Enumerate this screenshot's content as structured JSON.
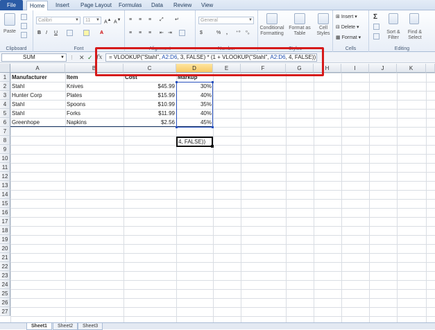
{
  "ribbon": {
    "tabs": [
      "File",
      "Home",
      "Insert",
      "Page Layout",
      "Formulas",
      "Data",
      "Review",
      "View"
    ],
    "active_tab": "Home",
    "clipboard": {
      "paste": "Paste",
      "label": "Clipboard"
    },
    "font": {
      "name": "Calibri",
      "size": "11",
      "label": "Font"
    },
    "alignment": {
      "label": "Alignment"
    },
    "number": {
      "format": "General",
      "label": "Number",
      "pct": "%",
      "comma": ",",
      "currency": "$"
    },
    "styles": {
      "conditional": "Conditional Formatting",
      "format_table": "Format as Table",
      "cell_styles": "Cell Styles",
      "label": "Styles"
    },
    "cells": {
      "insert": "Insert",
      "delete": "Delete",
      "format": "Format",
      "label": "Cells"
    },
    "editing": {
      "sum": "Σ",
      "sort": "Sort & Filter",
      "find": "Find & Select",
      "label": "Editing"
    }
  },
  "formula_bar": {
    "name_box": "SUM",
    "cancel": "✕",
    "enter": "✓",
    "fx": "fx",
    "formula_parts": [
      "= VLOOKUP(\"Stahl\", ",
      "A2:D6",
      ", 3, FALSE) * (1 + VLOOKUP(\"Stahl\", ",
      "A2:D6",
      ", 4, FALSE))"
    ]
  },
  "grid": {
    "columns": [
      "A",
      "B",
      "C",
      "D",
      "E",
      "F",
      "G",
      "H",
      "I",
      "J",
      "K"
    ],
    "selected_column": "D",
    "rows": [
      "1",
      "2",
      "3",
      "4",
      "5",
      "6",
      "7",
      "8",
      "9",
      "10",
      "11",
      "12",
      "13",
      "14",
      "15",
      "16",
      "17",
      "18",
      "19",
      "20",
      "21",
      "22",
      "23",
      "24",
      "25",
      "26",
      "27"
    ],
    "headers": {
      "a": "Manufacturer",
      "b": "Item",
      "c": "Cost",
      "d": "Markup"
    },
    "data": [
      {
        "manufacturer": "Stahl",
        "item": "Knives",
        "cost": "$45.99",
        "markup": "30%"
      },
      {
        "manufacturer": "Hunter Corp",
        "item": "Plates",
        "cost": "$15.99",
        "markup": "40%"
      },
      {
        "manufacturer": "Stahl",
        "item": "Spoons",
        "cost": "$10.99",
        "markup": "35%"
      },
      {
        "manufacturer": "Stahl",
        "item": "Forks",
        "cost": "$11.99",
        "markup": "40%"
      },
      {
        "manufacturer": "Greenhope",
        "item": "Napkins",
        "cost": "$2.56",
        "markup": "45%"
      }
    ],
    "active_cell_text": "4, FALSE))"
  },
  "sheets": [
    "Sheet1",
    "Sheet2",
    "Sheet3"
  ]
}
